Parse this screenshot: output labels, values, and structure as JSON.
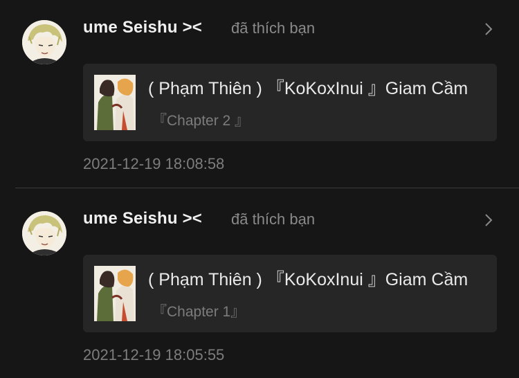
{
  "notifications": [
    {
      "user": "ume Seishu ><",
      "action": "đã thích bạn",
      "story_title": "( Phạm Thiên ) 『KoKoxInui 』Giam Cầm",
      "chapter": "『Chapter 2 』",
      "timestamp": "2021-12-19 18:08:58"
    },
    {
      "user": "ume Seishu ><",
      "action": "đã thích bạn",
      "story_title": "( Phạm Thiên ) 『KoKoxInui 』Giam Cầm",
      "chapter": "『Chapter 1』",
      "timestamp": "2021-12-19 18:05:55"
    }
  ],
  "icons": {
    "chevron": "chevron-right-icon",
    "avatar": "user-avatar",
    "thumbnail": "story-cover"
  },
  "colors": {
    "background": "#161616",
    "card": "#262626",
    "muted_text": "#7d7d7d"
  }
}
